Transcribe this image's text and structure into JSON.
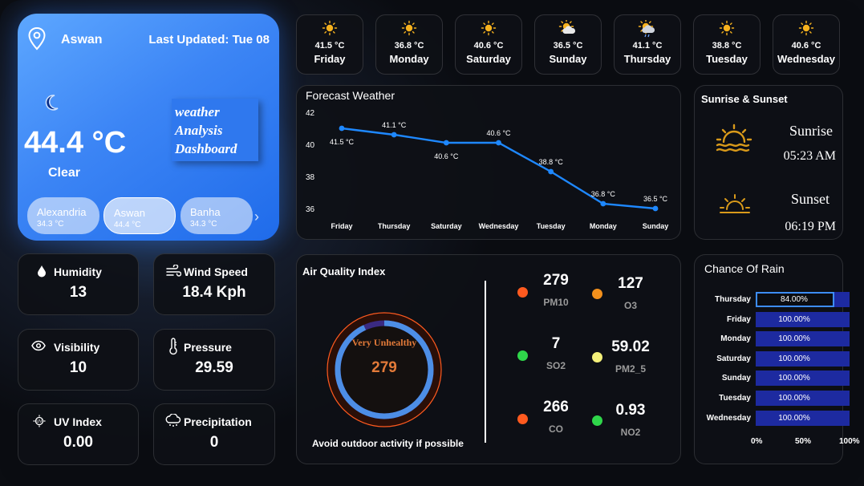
{
  "main": {
    "city": "Aswan",
    "last_updated": "Last Updated: Tue 08",
    "temperature": "44.4 °C",
    "condition": "Clear",
    "title_lines": [
      "weather",
      "Analysis",
      "Dashboard"
    ],
    "cities": [
      {
        "name": "Alexandria",
        "temp": "34.3 °C",
        "selected": false
      },
      {
        "name": "Aswan",
        "temp": "44.4 °C",
        "selected": true
      },
      {
        "name": "Banha",
        "temp": "34.3 °C",
        "selected": false
      }
    ],
    "next_icon": "chevron-right-icon"
  },
  "days": [
    {
      "temp": "41.5 °C",
      "day": "Friday",
      "icon": "sun-icon"
    },
    {
      "temp": "36.8 °C",
      "day": "Monday",
      "icon": "sun-icon"
    },
    {
      "temp": "40.6 °C",
      "day": "Saturday",
      "icon": "sun-icon"
    },
    {
      "temp": "36.5 °C",
      "day": "Sunday",
      "icon": "partly-cloudy-icon"
    },
    {
      "temp": "41.1 °C",
      "day": "Thursday",
      "icon": "sun-cloud-rain-icon"
    },
    {
      "temp": "38.8 °C",
      "day": "Tuesday",
      "icon": "sun-icon"
    },
    {
      "temp": "40.6 °C",
      "day": "Wednesday",
      "icon": "sun-icon"
    }
  ],
  "forecast": {
    "title": "Forecast Weather"
  },
  "chart_data": {
    "type": "line",
    "title": "Forecast Weather",
    "categories": [
      "Friday",
      "Thursday",
      "Saturday",
      "Wednesday",
      "Tuesday",
      "Monday",
      "Sunday"
    ],
    "values": [
      41.5,
      41.1,
      40.6,
      40.6,
      38.8,
      36.8,
      36.5
    ],
    "labels": [
      "41.5 °C",
      "41.1 °C",
      "40.6 °C",
      "40.6 °C",
      "38.8 °C",
      "36.8 °C",
      "36.5 °C"
    ],
    "yticks": [
      "42",
      "40",
      "38",
      "36"
    ],
    "ylim": [
      36,
      42
    ],
    "color": "#1e88ff"
  },
  "sun": {
    "title": "Sunrise & Sunset",
    "sunrise_label": "Sunrise",
    "sunrise_time": "05:23 AM",
    "sunset_label": "Sunset",
    "sunset_time": "06:19 PM",
    "icon_color": "#d99a1a"
  },
  "metrics": [
    {
      "label": "Humidity",
      "value": "13",
      "icon": "droplet-icon"
    },
    {
      "label": "Wind Speed",
      "value": "18.4 Kph",
      "icon": "wind-icon"
    },
    {
      "label": "Visibility",
      "value": "10",
      "icon": "eye-icon"
    },
    {
      "label": "Pressure",
      "value": "29.59",
      "icon": "thermometer-icon"
    },
    {
      "label": "UV Index",
      "value": "0.00",
      "icon": "uv-icon"
    },
    {
      "label": "Precipitation",
      "value": "0",
      "icon": "cloud-rain-icon"
    }
  ],
  "aqi": {
    "title": "Air Quality Index",
    "status": "Very Unhealthy",
    "value": "279",
    "advice": "Avoid outdoor activity if possible",
    "pollutants": [
      {
        "value": "279",
        "name": "PM10",
        "color": "#ff5a1f"
      },
      {
        "value": "127",
        "name": "O3",
        "color": "#f2901c"
      },
      {
        "value": "7",
        "name": "SO2",
        "color": "#2fd64a"
      },
      {
        "value": "59.02",
        "name": "PM2_5",
        "color": "#f4f07a"
      },
      {
        "value": "266",
        "name": "CO",
        "color": "#ff5a1f"
      },
      {
        "value": "0.93",
        "name": "NO2",
        "color": "#2fd64a"
      }
    ]
  },
  "rain": {
    "title": "Chance Of Rain",
    "rows": [
      {
        "day": "Thursday",
        "label": "84.00%",
        "value": 84
      },
      {
        "day": "Friday",
        "label": "100.00%",
        "value": 100
      },
      {
        "day": "Monday",
        "label": "100.00%",
        "value": 100
      },
      {
        "day": "Saturday",
        "label": "100.00%",
        "value": 100
      },
      {
        "day": "Sunday",
        "label": "100.00%",
        "value": 100
      },
      {
        "day": "Tuesday",
        "label": "100.00%",
        "value": 100
      },
      {
        "day": "Wednesday",
        "label": "100.00%",
        "value": 100
      }
    ],
    "ticks": [
      "0%",
      "50%",
      "100%"
    ]
  }
}
